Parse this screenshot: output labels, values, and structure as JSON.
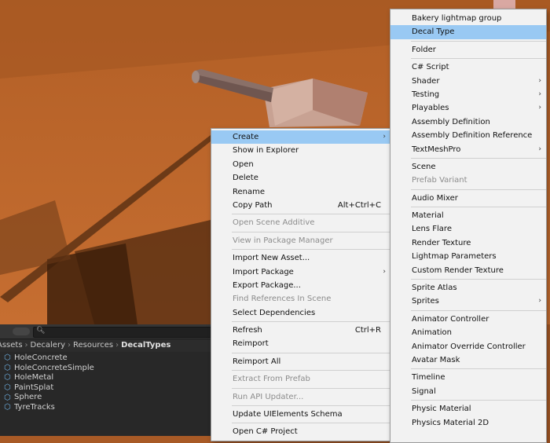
{
  "project": {
    "breadcrumb": [
      "Assets",
      "Decalery",
      "Resources",
      "DecalTypes"
    ],
    "assets": [
      "HoleConcrete",
      "HoleConcreteSimple",
      "HoleMetal",
      "PaintSplat",
      "Sphere",
      "TyreTracks"
    ]
  },
  "context_menu": {
    "items": [
      {
        "label": "Create",
        "submenu": true,
        "highlighted": true
      },
      {
        "label": "Show in Explorer"
      },
      {
        "label": "Open"
      },
      {
        "label": "Delete"
      },
      {
        "label": "Rename"
      },
      {
        "label": "Copy Path",
        "shortcut": "Alt+Ctrl+C"
      },
      {
        "separator": true
      },
      {
        "label": "Open Scene Additive",
        "disabled": true
      },
      {
        "separator": true
      },
      {
        "label": "View in Package Manager",
        "disabled": true
      },
      {
        "separator": true
      },
      {
        "label": "Import New Asset..."
      },
      {
        "label": "Import Package",
        "submenu": true
      },
      {
        "label": "Export Package..."
      },
      {
        "label": "Find References In Scene",
        "disabled": true
      },
      {
        "label": "Select Dependencies"
      },
      {
        "separator": true
      },
      {
        "label": "Refresh",
        "shortcut": "Ctrl+R"
      },
      {
        "label": "Reimport"
      },
      {
        "separator": true
      },
      {
        "label": "Reimport All"
      },
      {
        "separator": true
      },
      {
        "label": "Extract From Prefab",
        "disabled": true
      },
      {
        "separator": true
      },
      {
        "label": "Run API Updater...",
        "disabled": true
      },
      {
        "separator": true
      },
      {
        "label": "Update UIElements Schema"
      },
      {
        "separator": true
      },
      {
        "label": "Open C# Project"
      }
    ]
  },
  "create_menu": {
    "items": [
      {
        "label": "Bakery lightmap group"
      },
      {
        "label": "Decal Type",
        "highlighted": true
      },
      {
        "separator": true
      },
      {
        "label": "Folder"
      },
      {
        "separator": true
      },
      {
        "label": "C# Script"
      },
      {
        "label": "Shader",
        "submenu": true
      },
      {
        "label": "Testing",
        "submenu": true
      },
      {
        "label": "Playables",
        "submenu": true
      },
      {
        "label": "Assembly Definition"
      },
      {
        "label": "Assembly Definition Reference"
      },
      {
        "label": "TextMeshPro",
        "submenu": true
      },
      {
        "separator": true
      },
      {
        "label": "Scene"
      },
      {
        "label": "Prefab Variant",
        "disabled": true
      },
      {
        "separator": true
      },
      {
        "label": "Audio Mixer"
      },
      {
        "separator": true
      },
      {
        "label": "Material"
      },
      {
        "label": "Lens Flare"
      },
      {
        "label": "Render Texture"
      },
      {
        "label": "Lightmap Parameters"
      },
      {
        "label": "Custom Render Texture"
      },
      {
        "separator": true
      },
      {
        "label": "Sprite Atlas"
      },
      {
        "label": "Sprites",
        "submenu": true
      },
      {
        "separator": true
      },
      {
        "label": "Animator Controller"
      },
      {
        "label": "Animation"
      },
      {
        "label": "Animator Override Controller"
      },
      {
        "label": "Avatar Mask"
      },
      {
        "separator": true
      },
      {
        "label": "Timeline"
      },
      {
        "label": "Signal"
      },
      {
        "separator": true
      },
      {
        "label": "Physic Material"
      },
      {
        "label": "Physics Material 2D"
      }
    ]
  },
  "icons": {
    "submenu_arrow": "chevron-right-icon",
    "asset": "prefab-cube-icon",
    "search": "search-icon"
  },
  "colors": {
    "highlight": "#99c9f3",
    "menu_bg": "#f2f2f2",
    "ground": "#b4602a",
    "panel_bg": "#282828"
  }
}
